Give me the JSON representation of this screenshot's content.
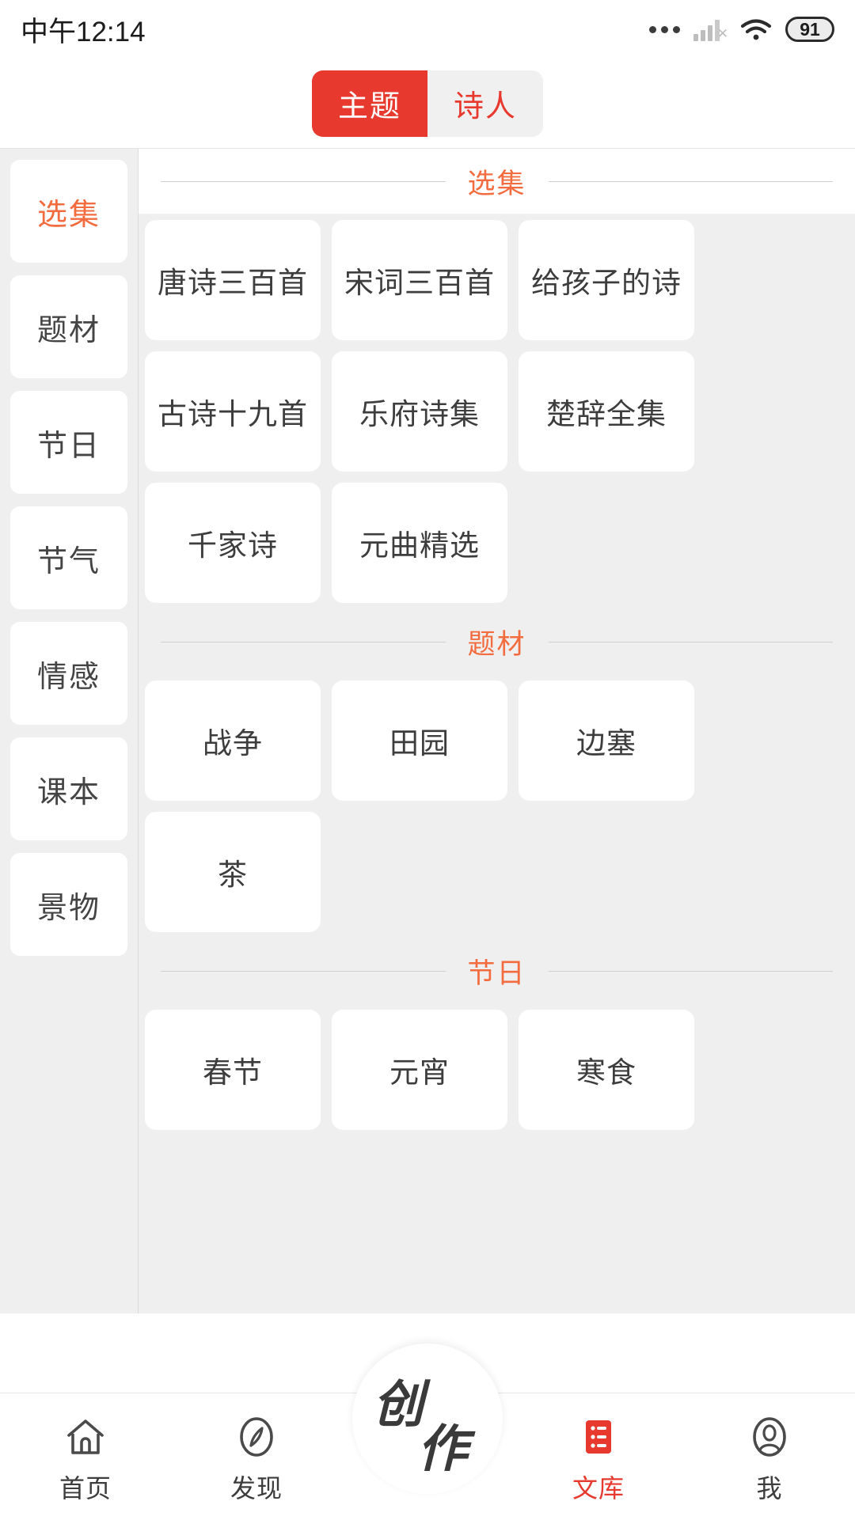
{
  "status_bar": {
    "time": "中午12:14",
    "battery_level": "91",
    "icons": [
      "more-dots-icon",
      "cellular-signal-off-icon",
      "wifi-icon",
      "battery-icon"
    ]
  },
  "top_tabs": {
    "items": [
      {
        "label": "主题",
        "active": true
      },
      {
        "label": "诗人",
        "active": false
      }
    ]
  },
  "sidebar": {
    "items": [
      {
        "label": "选集",
        "active": true
      },
      {
        "label": "题材",
        "active": false
      },
      {
        "label": "节日",
        "active": false
      },
      {
        "label": "节气",
        "active": false
      },
      {
        "label": "情感",
        "active": false
      },
      {
        "label": "课本",
        "active": false
      },
      {
        "label": "景物",
        "active": false
      }
    ]
  },
  "content": {
    "sections": [
      {
        "title": "选集",
        "header_on_white": true,
        "cards": [
          "唐诗三百首",
          "宋词三百首",
          "给孩子的诗",
          "古诗十九首",
          "乐府诗集",
          "楚辞全集",
          "千家诗",
          "元曲精选"
        ]
      },
      {
        "title": "题材",
        "header_on_white": false,
        "cards": [
          "战争",
          "田园",
          "边塞",
          "茶"
        ]
      },
      {
        "title": "节日",
        "header_on_white": false,
        "cards": [
          "春节",
          "元宵",
          "寒食"
        ]
      }
    ]
  },
  "bottom_nav": {
    "items": [
      {
        "label": "首页",
        "icon": "home-icon",
        "active": false
      },
      {
        "label": "发现",
        "icon": "compass-icon",
        "active": false
      },
      {
        "label": "文库",
        "icon": "list-icon",
        "active": true
      },
      {
        "label": "我",
        "icon": "person-icon",
        "active": false
      }
    ],
    "fab": {
      "chars": [
        "创",
        "作"
      ],
      "name": "create-button"
    }
  },
  "colors": {
    "accent_red": "#e8392e",
    "accent_orange": "#f26c3f",
    "bg_gray": "#efefef",
    "card_white": "#ffffff"
  }
}
